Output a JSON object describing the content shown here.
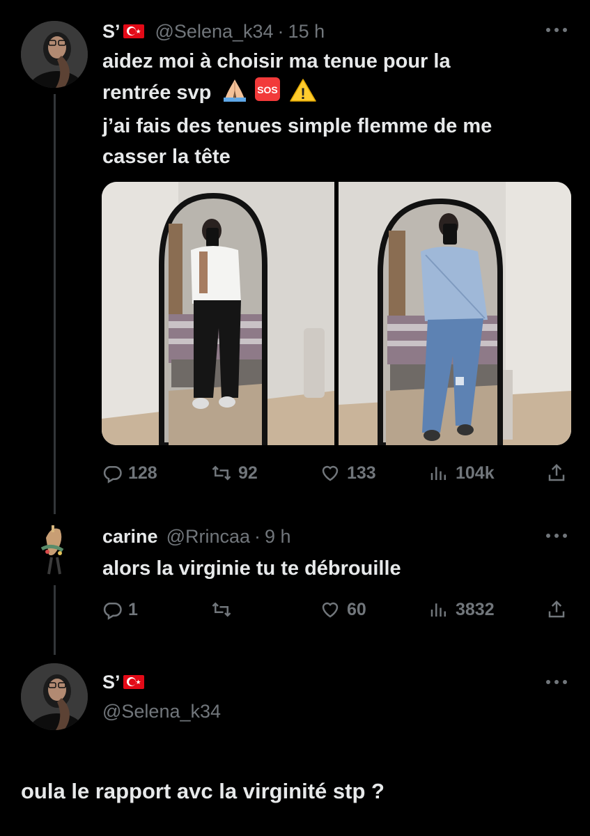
{
  "tweet1": {
    "display_name": "S’",
    "handle": "@Selena_k34",
    "dot": "·",
    "time": "15 h",
    "text_line1": "aidez moi à choisir ma tenue pour la",
    "text_line2": "rentrée  svp",
    "text_line3": "j’ai fais des tenues simple flemme de me",
    "text_line4": "casser la tête",
    "emojis": [
      "folded-hands",
      "sos",
      "warning"
    ],
    "sos_label": "SOS",
    "warning_label": "!",
    "replies": "128",
    "retweets": "92",
    "likes": "133",
    "views": "104k"
  },
  "reply1": {
    "display_name": "carine",
    "handle": "@Rrincaa",
    "dot": "·",
    "time": "9 h",
    "text": "alors la virginie tu te débrouille",
    "replies": "1",
    "retweets": "",
    "likes": "60",
    "views": "3832"
  },
  "tweet2": {
    "display_name": "S’",
    "handle": "@Selena_k34",
    "text": "oula le rapport avc la virginité stp ?"
  },
  "colors": {
    "background": "#000000",
    "text": "#e7e9ea",
    "muted": "#71767b",
    "thread_line": "#333639",
    "flag_red": "#e30a17"
  }
}
